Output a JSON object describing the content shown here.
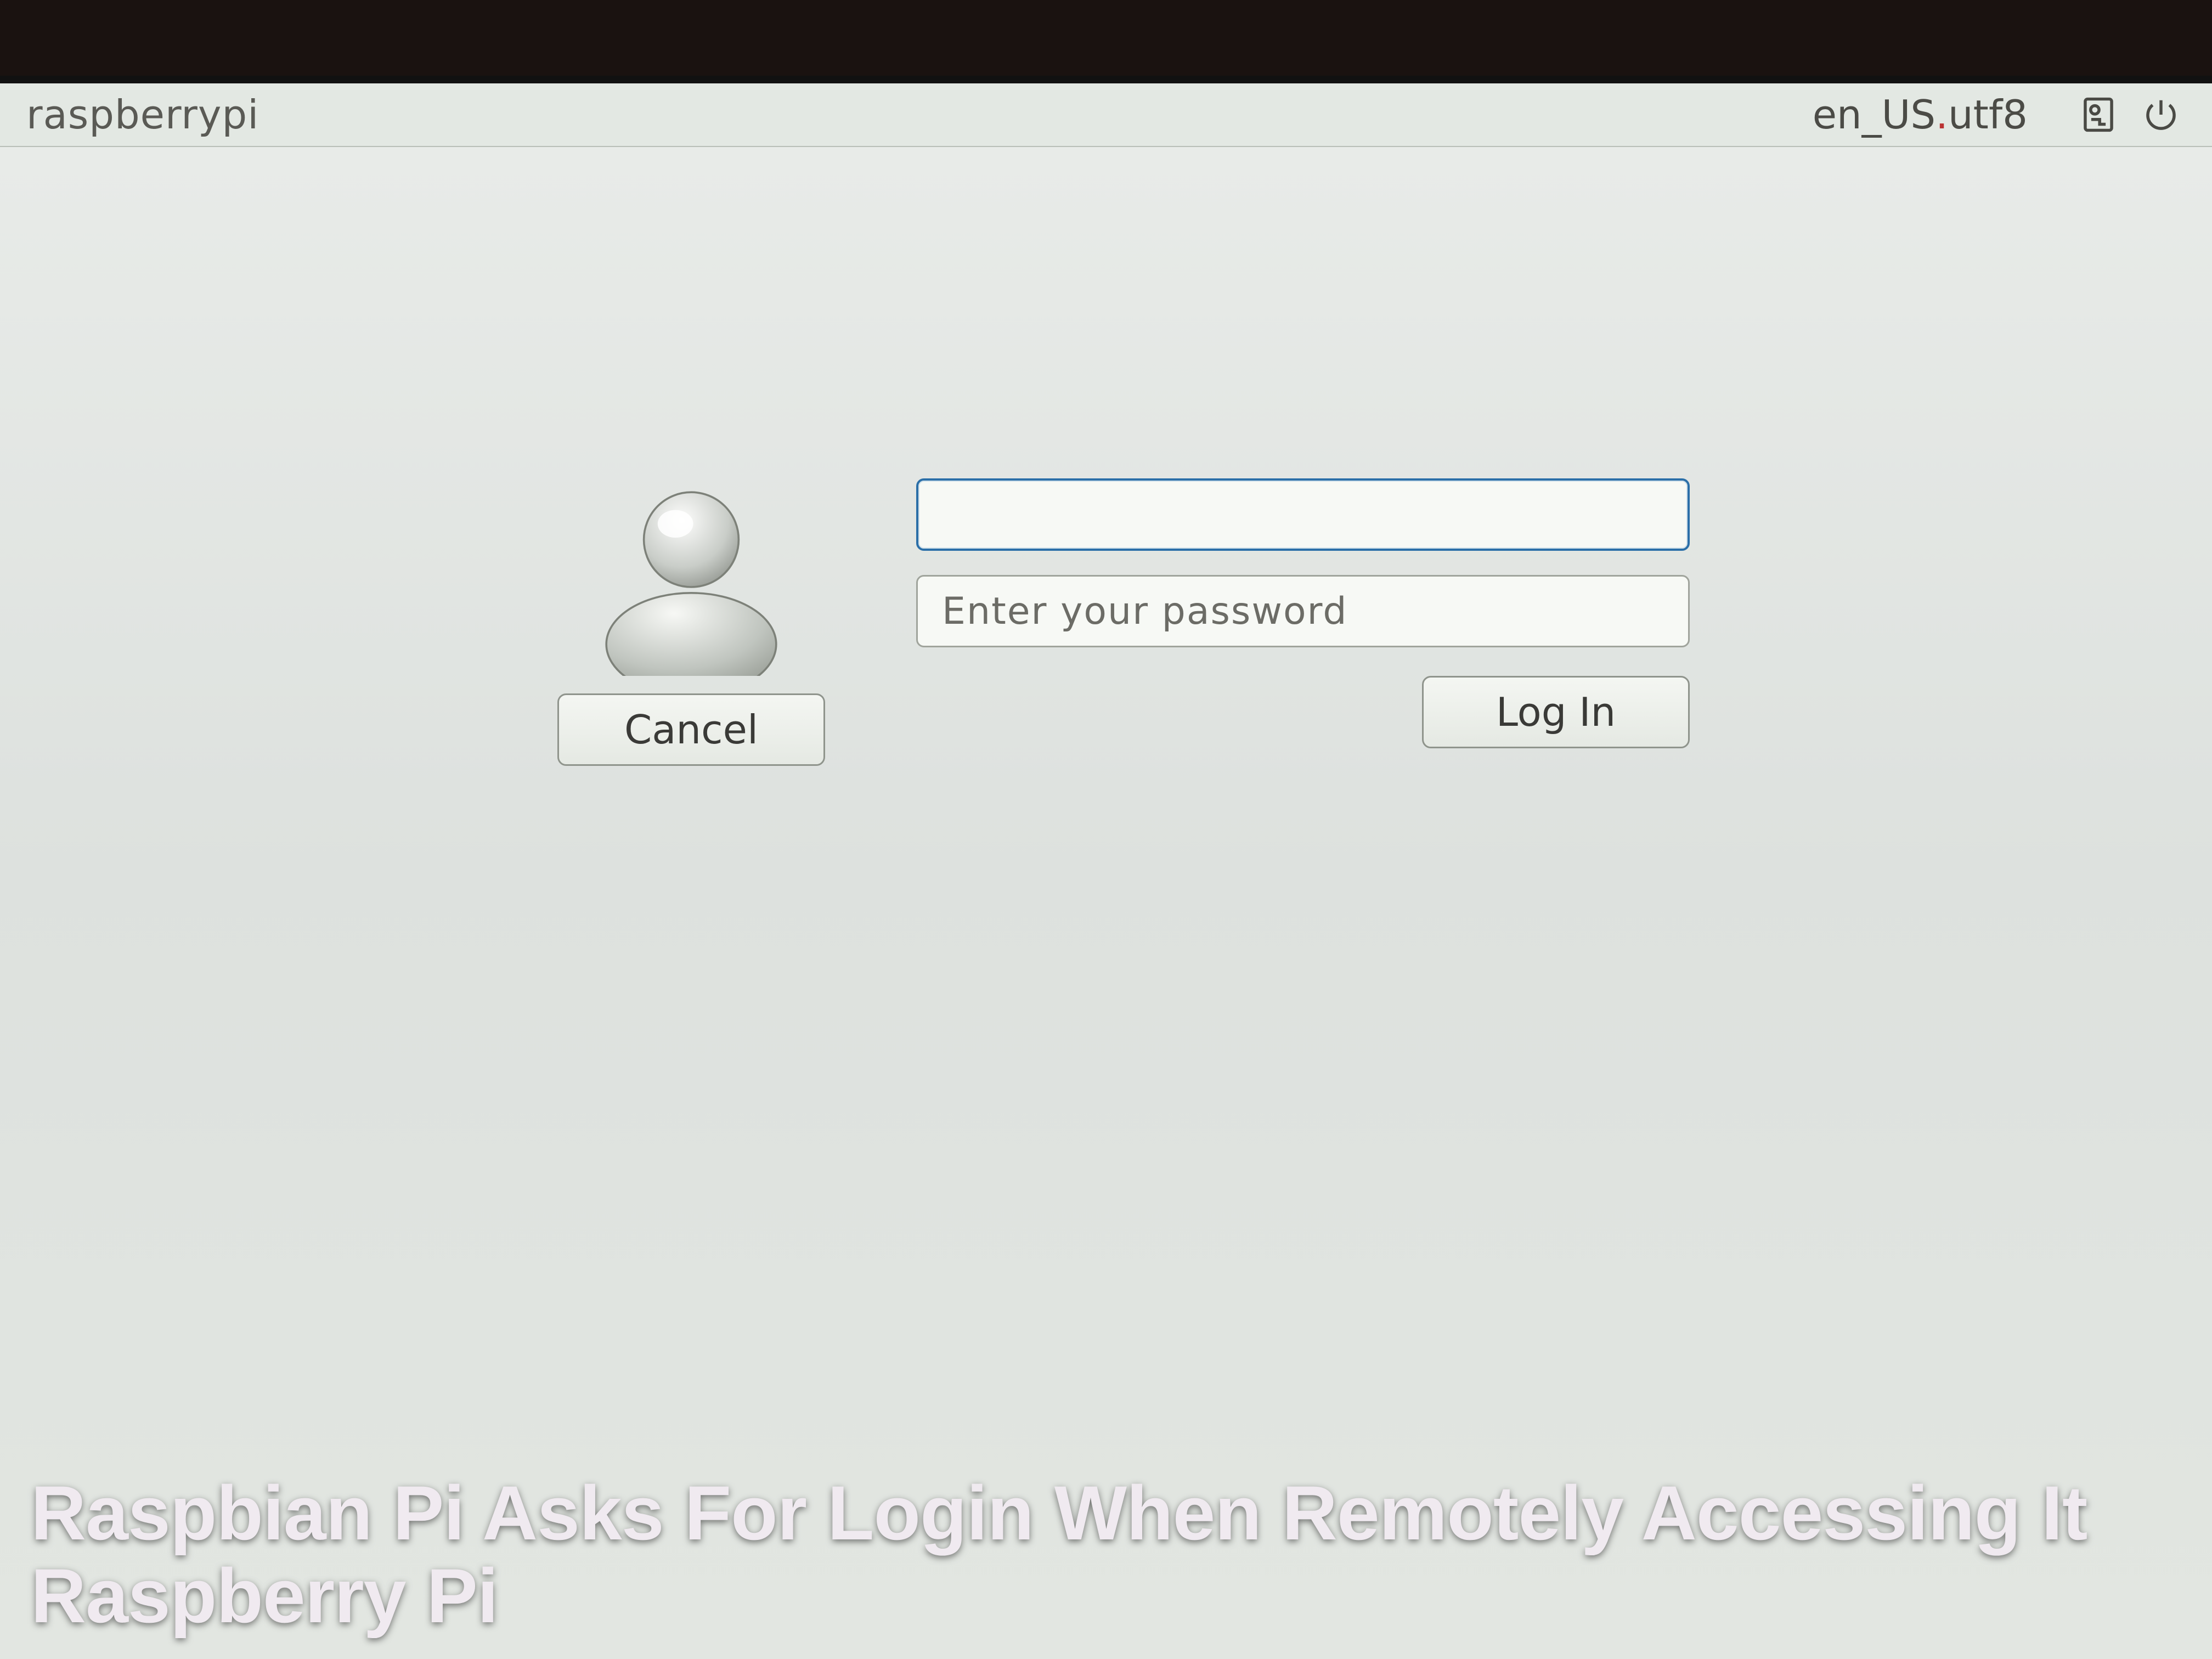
{
  "topbar": {
    "hostname": "raspberrypi",
    "locale_prefix": "en_US",
    "locale_suffix": "utf8",
    "accessibility_icon": "accessibility-icon",
    "power_icon": "power-icon"
  },
  "login": {
    "username_value": "",
    "password_value": "",
    "password_placeholder": "Enter your password",
    "cancel_label": "Cancel",
    "login_label": "Log In"
  },
  "caption": "Raspbian Pi Asks For Login When Remotely Accessing It Raspberry Pi"
}
